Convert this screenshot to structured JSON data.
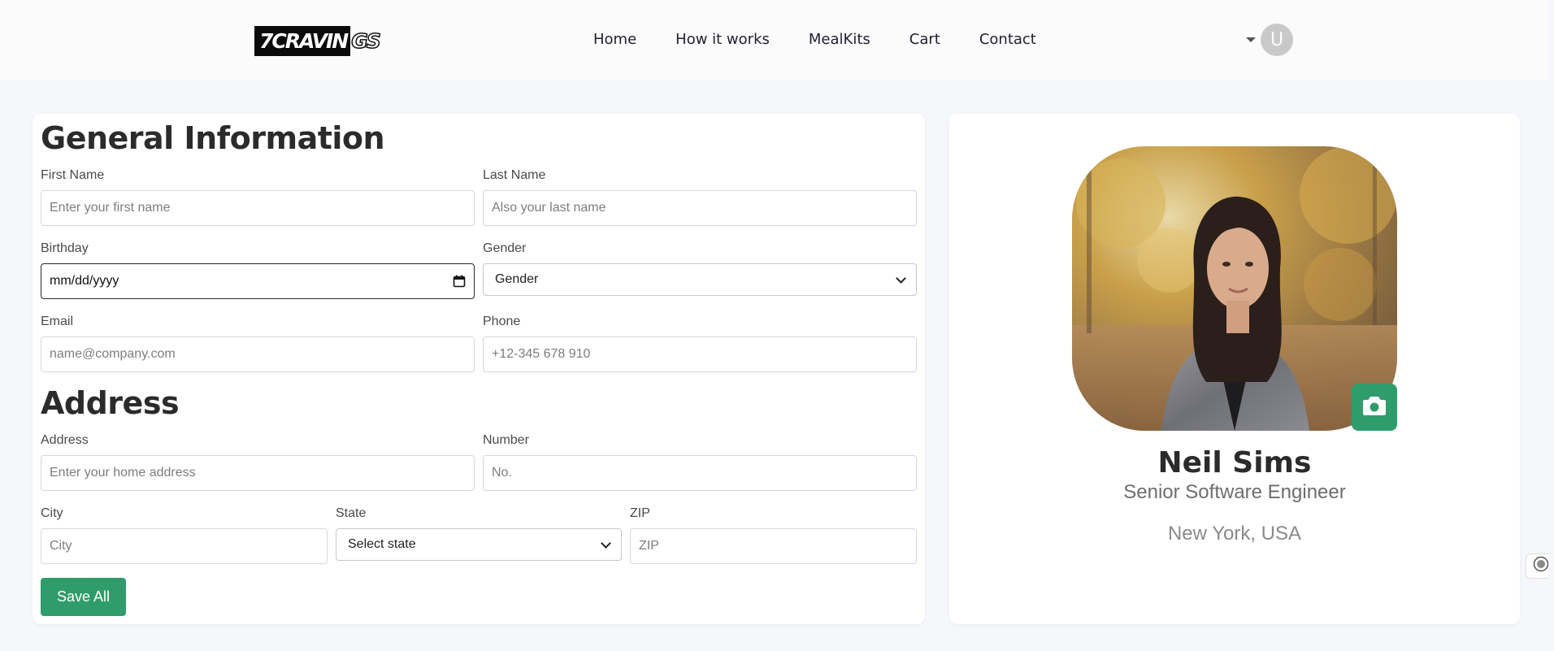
{
  "brand": {
    "logo_main": "7CRAVIN",
    "logo_tail": "GS"
  },
  "nav": {
    "items": [
      "Home",
      "How it works",
      "MealKits",
      "Cart",
      "Contact"
    ]
  },
  "user_menu": {
    "avatar_initial": "U"
  },
  "general": {
    "heading": "General Information",
    "first_name": {
      "label": "First Name",
      "placeholder": "Enter your first name"
    },
    "last_name": {
      "label": "Last Name",
      "placeholder": "Also your last name"
    },
    "birthday": {
      "label": "Birthday",
      "value": "mm/dd/yyyy"
    },
    "gender": {
      "label": "Gender",
      "selected": "Gender"
    },
    "email": {
      "label": "Email",
      "placeholder": "name@company.com"
    },
    "phone": {
      "label": "Phone",
      "placeholder": "+12-345 678 910"
    }
  },
  "address": {
    "heading": "Address",
    "address": {
      "label": "Address",
      "placeholder": "Enter your home address"
    },
    "number": {
      "label": "Number",
      "placeholder": "No."
    },
    "city": {
      "label": "City",
      "placeholder": "City"
    },
    "state": {
      "label": "State",
      "selected": "Select state"
    },
    "zip": {
      "label": "ZIP",
      "placeholder": "ZIP"
    }
  },
  "actions": {
    "save_label": "Save All"
  },
  "profile": {
    "name": "Neil Sims",
    "title": "Senior Software Engineer",
    "location": "New York, USA"
  },
  "colors": {
    "accent_green": "#2f9d6b",
    "page_bg": "#f5f7fa",
    "card_bg": "#ffffff"
  },
  "icons": {
    "camera": "camera-icon",
    "calendar": "calendar-icon",
    "caret": "caret-down-icon"
  }
}
